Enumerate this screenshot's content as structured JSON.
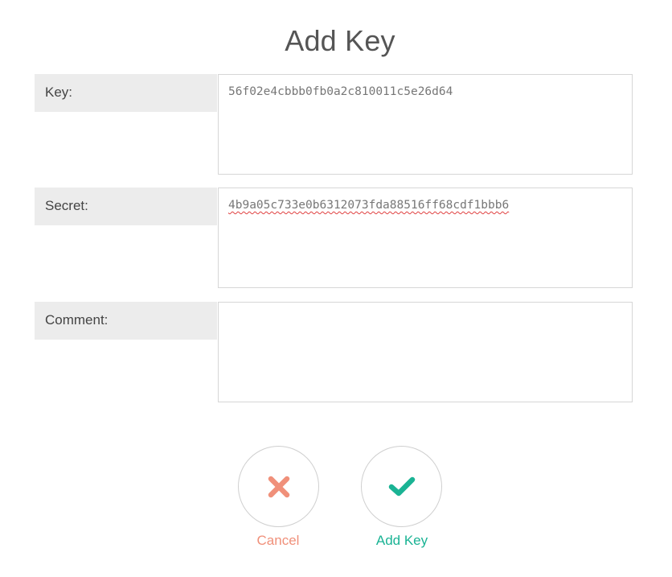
{
  "dialog": {
    "title": "Add Key"
  },
  "fields": {
    "key": {
      "label": "Key:",
      "value": "56f02e4cbbb0fb0a2c810011c5e26d64"
    },
    "secret": {
      "label": "Secret:",
      "value": "4b9a05c733e0b6312073fda88516ff68cdf1bbb6"
    },
    "comment": {
      "label": "Comment:",
      "value": ""
    }
  },
  "actions": {
    "cancel": {
      "label": "Cancel",
      "icon": "close-icon",
      "color": "#f0907a"
    },
    "confirm": {
      "label": "Add Key",
      "icon": "checkmark-icon",
      "color": "#1ab394"
    }
  }
}
